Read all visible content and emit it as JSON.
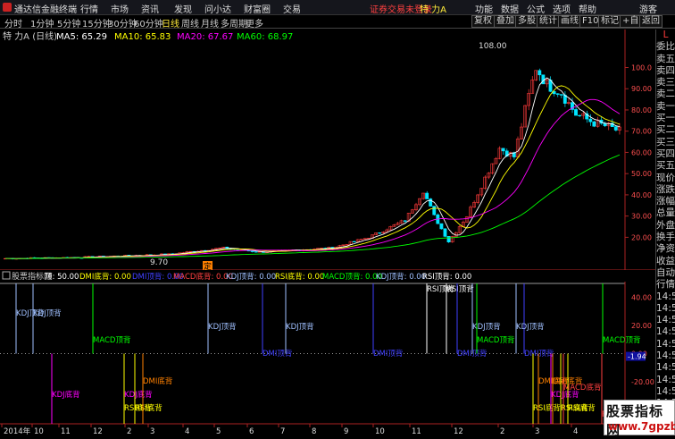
{
  "titlebar": {
    "app_name": "通达信金融终端",
    "menus": [
      "行情",
      "市场",
      "资讯",
      "发现",
      "问小达",
      "财富圈",
      "交易"
    ],
    "notice": "证券交易未登录",
    "stock_name": "特 力A",
    "right_menus": [
      "功能",
      "数据",
      "公式",
      "选项",
      "帮助",
      "游客"
    ]
  },
  "toolbar": {
    "periods": [
      "分时",
      "1分钟",
      "5分钟",
      "15分钟",
      "30分钟",
      "60分钟",
      "日线",
      "周线",
      "月线",
      "多周期",
      "更多"
    ],
    "active_period": "日线",
    "buttons": [
      "复权",
      "叠加",
      "多股",
      "统计",
      "画线",
      "F10",
      "标记",
      "+自选",
      "返回"
    ]
  },
  "chart_header": {
    "name": "特 力A (日线)",
    "ma": [
      {
        "label": "MA5: 65.29",
        "color": "#ffffff"
      },
      {
        "label": "MA10: 65.83",
        "color": "#ffff00"
      },
      {
        "label": "MA20: 67.67",
        "color": "#ff00ff"
      },
      {
        "label": "MA60: 68.97",
        "color": "#00ff00"
      }
    ]
  },
  "price_axis": {
    "ticks": [
      "100.0",
      "90.00",
      "80.00",
      "70.00",
      "60.00",
      "50.00",
      "40.00",
      "30.00",
      "20.00"
    ]
  },
  "indicator_header": {
    "title": "股票指标网",
    "items": [
      {
        "label": "顶: 50.00",
        "color": "#ffffff"
      },
      {
        "label": "DMI底背: 0.00",
        "color": "#ffff00"
      },
      {
        "label": "DMI顶背: 0.00",
        "color": "#4040ff"
      },
      {
        "label": "MACD底背: 0.00",
        "color": "#ff4040"
      },
      {
        "label": "KDJ顶背: 0.00",
        "color": "#a0c0ff"
      },
      {
        "label": "RSI底背: 0.00",
        "color": "#ffff00"
      },
      {
        "label": "MACD顶背: 0.00",
        "color": "#00ff00"
      },
      {
        "label": "KDJ顶背: 0.00",
        "color": "#a0c0ff"
      },
      {
        "label": "RSI顶背: 0.00",
        "color": "#ffffff"
      }
    ]
  },
  "indicator_axis": {
    "ticks": [
      "40.00",
      "20.00",
      "0.00",
      "-20.00",
      "-40.00"
    ],
    "current": "-1.94"
  },
  "annotations": {
    "high": "108.00",
    "low": "9.70",
    "badge": "定"
  },
  "date_axis": [
    "2014年",
    "10",
    "11",
    "12",
    "2",
    "3",
    "4",
    "5",
    "6",
    "7",
    "8",
    "9",
    "10",
    "11",
    "12",
    "2",
    "3",
    "4"
  ],
  "signal_labels": {
    "kdj_top": "KDJ顶背",
    "macd_top": "MACD顶背",
    "dmi_top": "DMI顶背",
    "rsi_top": "RSI顶背",
    "kdj_bottom": "KDJ底背",
    "dmi_bottom": "DMI底背",
    "macd_bottom": "MACD底背",
    "rsi_bottom": "RSI底背"
  },
  "sidebar": [
    "L",
    "委比",
    "卖五",
    "卖四",
    "卖三",
    "卖二",
    "卖一",
    "买一",
    "买二",
    "买三",
    "买四",
    "买五",
    "现价",
    "涨跌",
    "涨幅",
    "总量",
    "外盘",
    "换手",
    "净资",
    "收益",
    "自动",
    "行情",
    "14:5",
    "14:5",
    "14:5",
    "14:5",
    "14:5",
    "14:5",
    "14:5",
    "14:5",
    "14:5",
    "14:5"
  ],
  "watermark": {
    "line1": "股票指标网",
    "line2": "www.7gpzb.com"
  },
  "colors": {
    "up": "#ff3b3b",
    "down": "#00e5ff",
    "ma5": "#ffffff",
    "ma10": "#ffff00",
    "ma20": "#ff00ff",
    "ma60": "#00ff00"
  }
}
